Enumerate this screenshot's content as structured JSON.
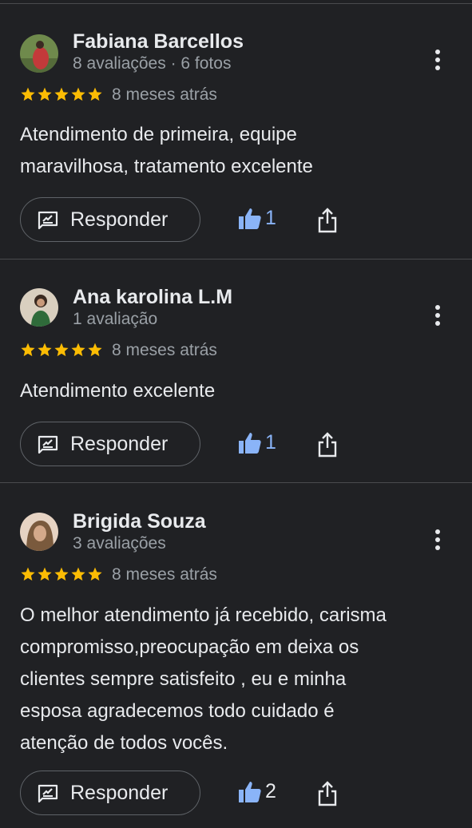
{
  "reviews": [
    {
      "name": "Fabiana Barcellos",
      "meta": "8 avaliações · 6 fotos",
      "rating": 5,
      "time": "8 meses atrás",
      "text_lines": [
        "Atendimento de primeira, equipe",
        "maravilhosa, tratamento excelente"
      ],
      "reply_label": "Responder",
      "likes": "1",
      "avatar_colors": [
        "#6f8a4c",
        "#c33a3a"
      ]
    },
    {
      "name": "Ana karolina L.M",
      "meta": "1 avaliação",
      "rating": 5,
      "time": "8 meses atrás",
      "text_lines": [
        "Atendimento excelente"
      ],
      "reply_label": "Responder",
      "likes": "1",
      "avatar_colors": [
        "#d9cfbf",
        "#2f6b3a"
      ]
    },
    {
      "name": "Brigida Souza",
      "meta": "3 avaliações",
      "rating": 5,
      "time": "8 meses atrás",
      "text_lines": [
        "O melhor atendimento já recebido, carisma",
        "compromisso,preocupação em deixa os",
        "clientes sempre satisfeito , eu e minha",
        "esposa agradecemos todo cuidado é",
        "atenção de todos vocês."
      ],
      "reply_label": "Responder",
      "likes": "2",
      "avatar_colors": [
        "#e6d3c3",
        "#7a5a3d"
      ]
    }
  ],
  "colors": {
    "background": "#202124",
    "star": "#fbbc04",
    "like_accent": "#8ab4f8",
    "secondary_text": "#9aa0a6"
  },
  "icons": [
    "kebab-menu-icon",
    "star-icon",
    "reply-icon",
    "thumb-up-icon",
    "share-icon"
  ]
}
